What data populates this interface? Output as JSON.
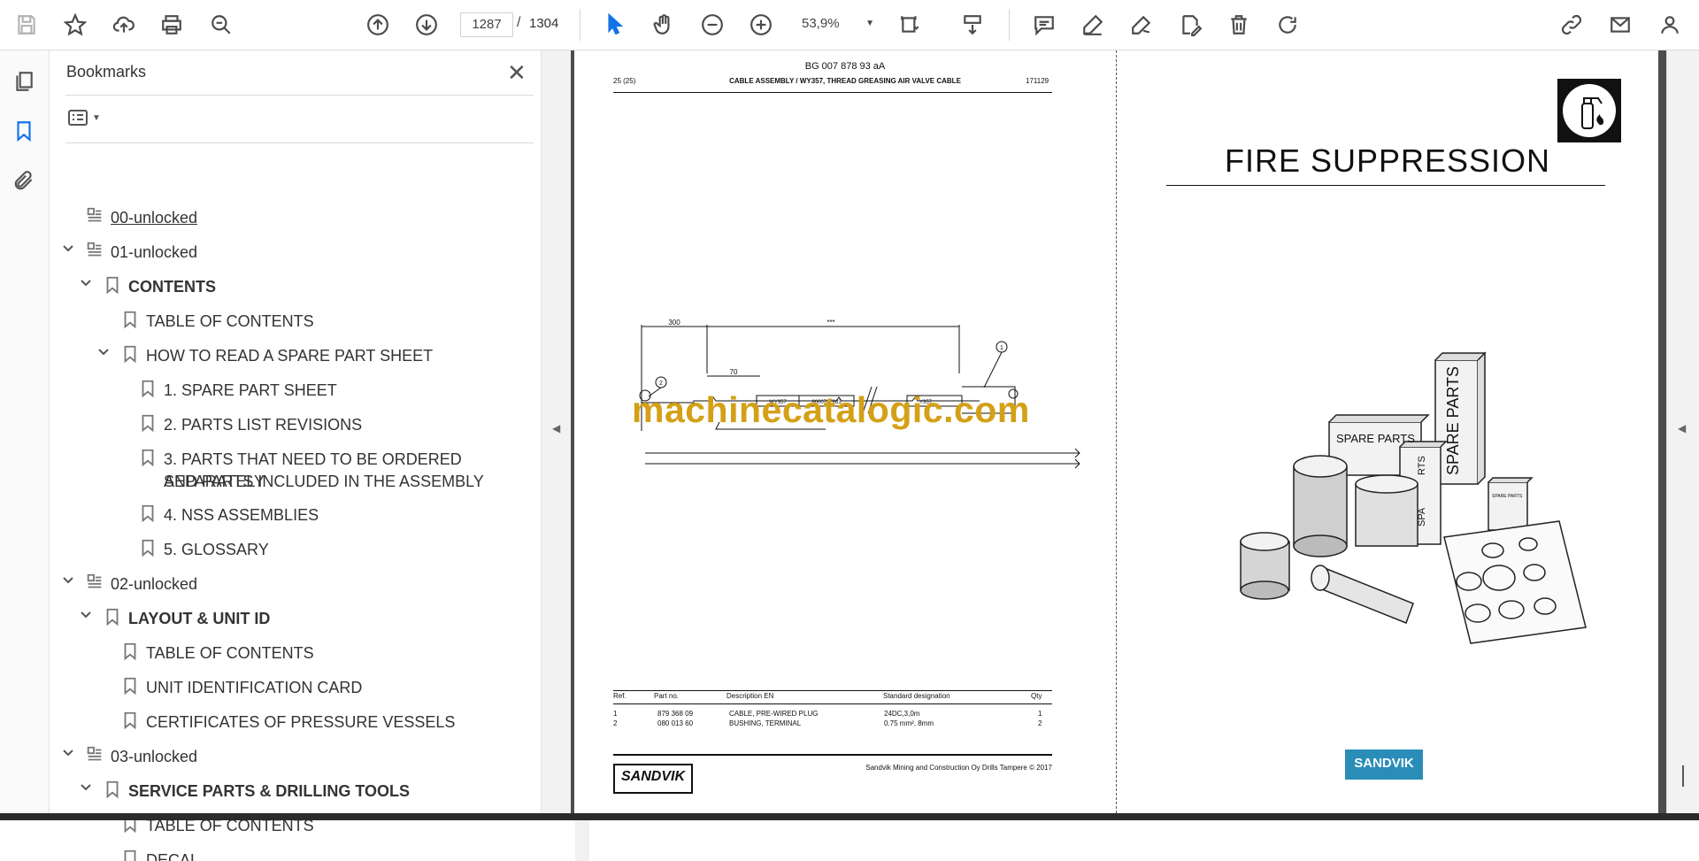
{
  "toolbar": {
    "page_current": "1287",
    "page_separator": "/",
    "page_total": "1304",
    "zoom": "53,9%",
    "icons": [
      "save-icon",
      "star-icon",
      "upload-cloud-icon",
      "print-icon",
      "zoom-search-icon",
      "page-up-icon",
      "page-down-icon",
      "select-cursor-icon",
      "hand-icon",
      "zoom-out-icon",
      "zoom-in-icon",
      "fit-page-icon",
      "scroll-mode-icon",
      "comment-icon",
      "highlight-icon",
      "sign-icon",
      "fill-sign-icon",
      "delete-icon",
      "rotate-icon",
      "share-link-icon",
      "email-icon",
      "user-icon"
    ]
  },
  "bookmarks": {
    "title": "Bookmarks",
    "items": [
      {
        "label": "00-unlocked"
      },
      {
        "label": "01-unlocked"
      },
      {
        "label": "CONTENTS"
      },
      {
        "label": "TABLE OF CONTENTS"
      },
      {
        "label": "HOW TO READ A SPARE PART SHEET"
      },
      {
        "label": "1. SPARE PART SHEET"
      },
      {
        "label": "2. PARTS LIST REVISIONS"
      },
      {
        "label": "3. PARTS THAT NEED TO BE ORDERED SEPARATELY",
        "label2": "AND PARTS INCLUDED IN THE ASSEMBLY"
      },
      {
        "label": "4. NSS ASSEMBLIES"
      },
      {
        "label": "5. GLOSSARY"
      },
      {
        "label": "02-unlocked"
      },
      {
        "label": "LAYOUT & UNIT ID"
      },
      {
        "label": "TABLE OF CONTENTS"
      },
      {
        "label": "UNIT IDENTIFICATION CARD"
      },
      {
        "label": "CERTIFICATES OF PRESSURE VESSELS"
      },
      {
        "label": "03-unlocked"
      },
      {
        "label": "SERVICE PARTS & DRILLING TOOLS"
      },
      {
        "label": "TABLE OF CONTENTS"
      },
      {
        "label": "DECAL"
      }
    ]
  },
  "page1": {
    "doc_id": "BG 007 878 93 aA",
    "page_ref": "25 (25)",
    "heading": "CABLE ASSEMBLY / WY357, THREAD GREASING AIR VALVE CABLE",
    "date_code": "171129",
    "dim_300": "300",
    "dim_stars": "***",
    "dim_70": "70",
    "label_wy357": "WY357",
    "label_part": "8600787883",
    "label_y357": "Y357",
    "callout_1": "1",
    "callout_2": "2",
    "watermark": "machinecatalogic.com",
    "table": {
      "headers": [
        "Ref.",
        "Part no.",
        "Description EN",
        "Standard designation",
        "Qty"
      ],
      "rows": [
        [
          "1",
          "879 368 09",
          "CABLE, PRE-WIRED PLUG",
          "24DC,3,0m",
          "1"
        ],
        [
          "2",
          "080 013 60",
          "BUSHING, TERMINAL",
          "0.75 mm², 8mm",
          "2"
        ]
      ]
    },
    "logo": "SANDVIK",
    "footer": "Sandvik Mining and Construction Oy Drills Tampere © 2017"
  },
  "page2": {
    "title": "FIRE SUPPRESSION",
    "box_label_1": "SPARE PARTS",
    "box_label_2": "SPARE PARTS",
    "box_label_3": "RTS",
    "box_label_4": "SPA",
    "box_label_5": "SPARE PARTS",
    "logo": "SANDVIK"
  },
  "colors": {
    "watermark": "#d4a017",
    "sandvik_blue": "#2a8db8",
    "doc_background": "#4d4d4d",
    "active_icon": "#1473e6"
  }
}
